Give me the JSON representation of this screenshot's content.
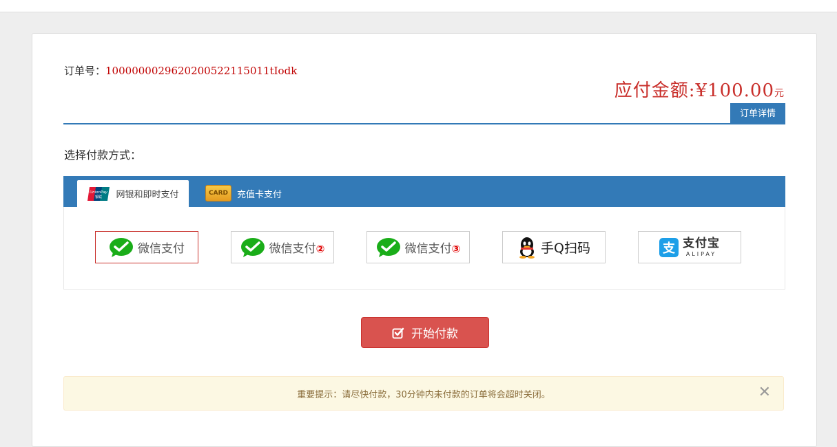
{
  "order": {
    "label": "订单号：",
    "number": "10000000296202005221150 11tIodk"
  },
  "amount": {
    "label": "应付金额:¥100.00",
    "unit": "元",
    "value": 100.0
  },
  "detail_button": "订单详情",
  "choose_label": "选择付款方式：",
  "tabs": [
    {
      "label": "网银和即时支付",
      "icon": "unionpay-icon",
      "active": true
    },
    {
      "label": "充值卡支付",
      "icon": "card-icon",
      "icon_text": "CARD",
      "active": false
    }
  ],
  "methods": [
    {
      "label": "微信支付",
      "suffix": "",
      "icon": "wechat-icon",
      "selected": true
    },
    {
      "label": "微信支付",
      "suffix": "②",
      "icon": "wechat-icon",
      "selected": false
    },
    {
      "label": "微信支付",
      "suffix": "③",
      "icon": "wechat-icon",
      "selected": false
    },
    {
      "label": "手Q扫码",
      "suffix": "",
      "icon": "qq-icon",
      "selected": false
    },
    {
      "label": "支付宝",
      "sublabel": "ALIPAY",
      "icon": "alipay-icon",
      "selected": false
    }
  ],
  "pay_button": "开始付款",
  "notice": "重要提示：请尽快付款，30分钟内未付款的订单将会超时关闭。",
  "colors": {
    "primary": "#337ab7",
    "danger": "#d9534f",
    "amount": "#c9302c",
    "wechat": "#1aad19",
    "alipay": "#1d9fe8"
  }
}
